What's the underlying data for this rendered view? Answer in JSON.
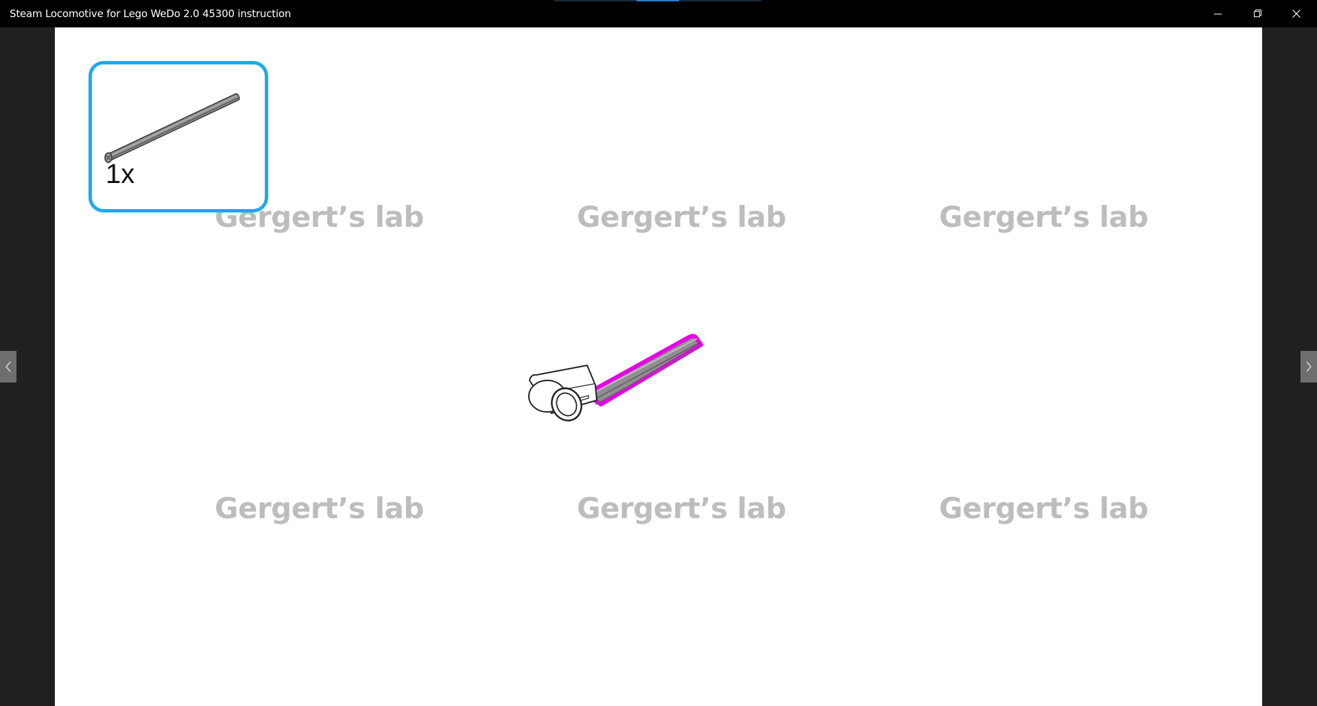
{
  "window": {
    "title": "Steam Locomotive for Lego WeDo 2.0 45300 instruction",
    "accent_color": "#1fa9e8",
    "highlight_color": "#e600e6"
  },
  "titlebar_buttons": {
    "minimize_icon": "minimize-icon",
    "restore_icon": "restore-icon",
    "close_icon": "close-icon"
  },
  "parts_list": {
    "items": [
      {
        "part": "axle",
        "quantity": "1x"
      }
    ]
  },
  "watermarks": [
    "Gergert’s lab",
    "Gergert’s lab",
    "Gergert’s lab",
    "Gergert’s lab",
    "Gergert’s lab",
    "Gergert’s lab"
  ],
  "navigation": {
    "previous_icon": "chevron-left-icon",
    "next_icon": "chevron-right-icon"
  }
}
